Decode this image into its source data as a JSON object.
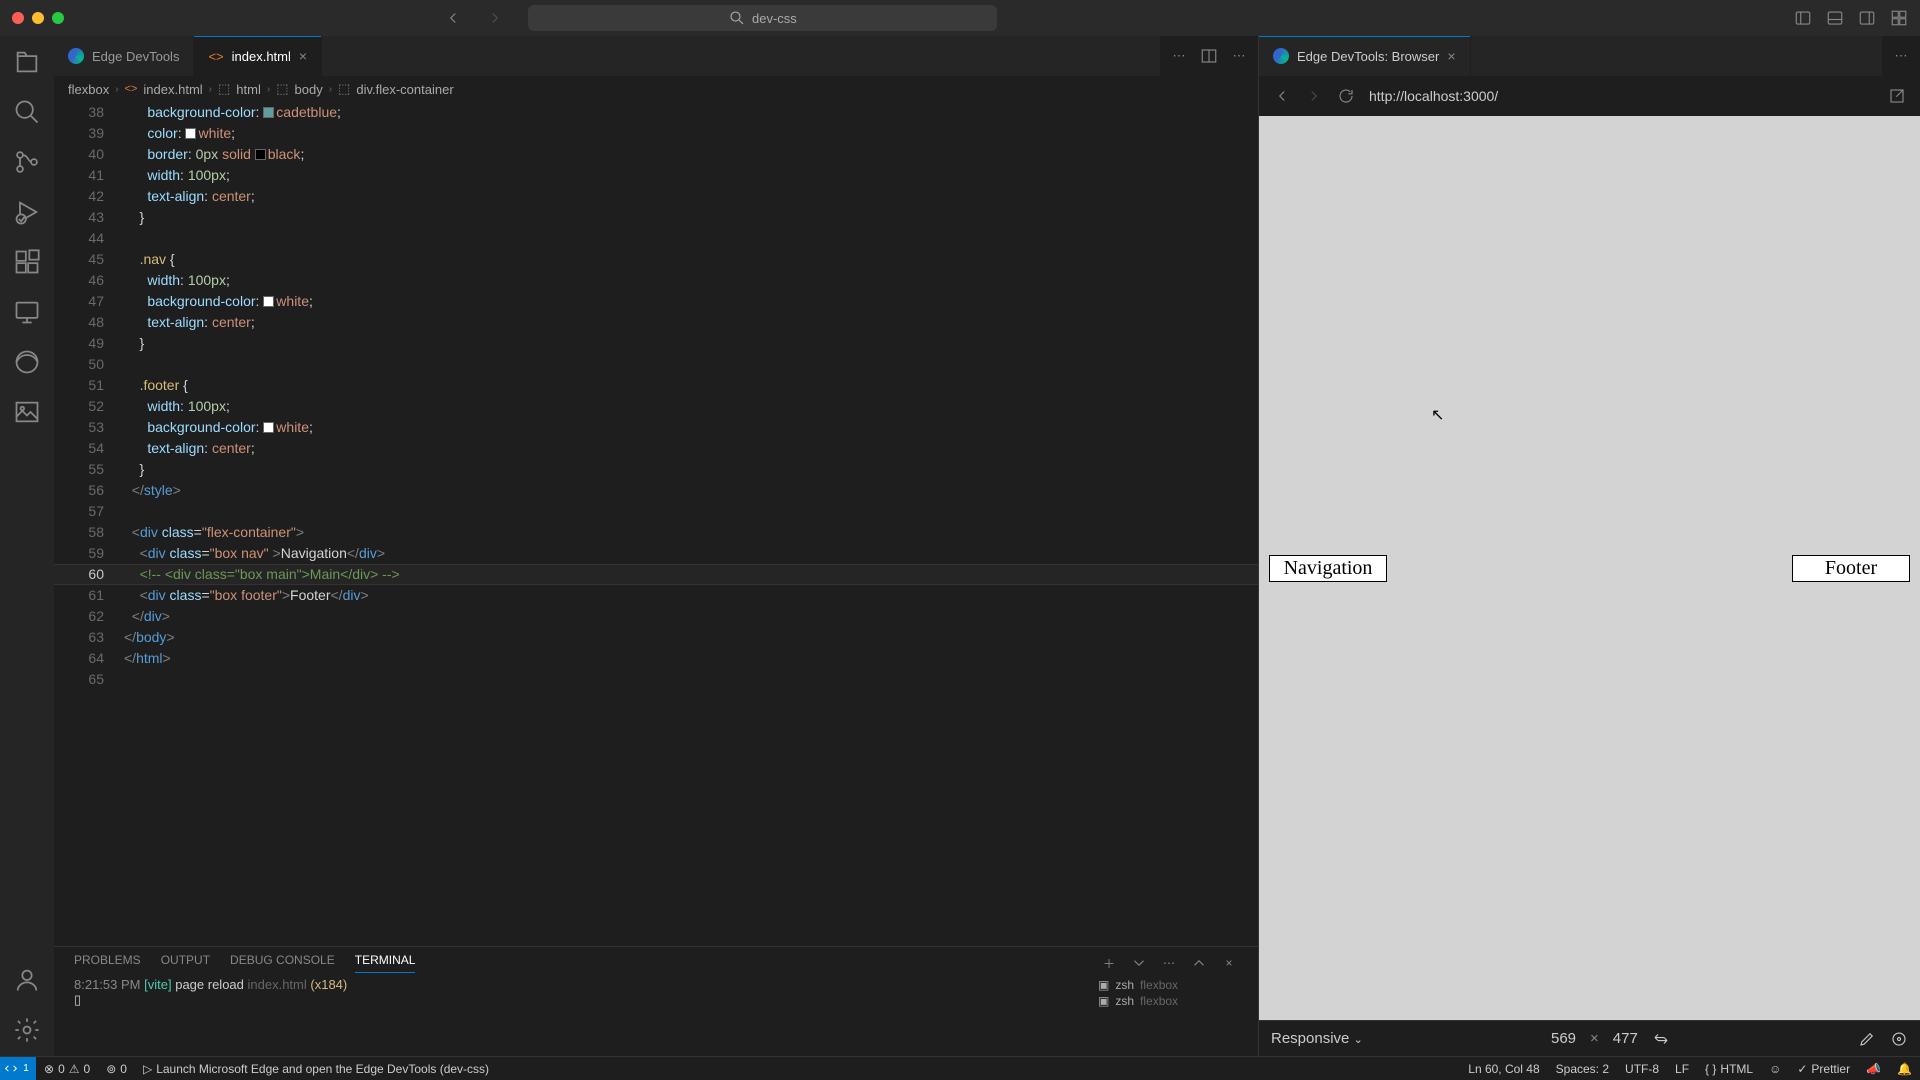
{
  "titlebar": {
    "search": "dev-css"
  },
  "tabs": {
    "left": [
      {
        "label": "Edge DevTools",
        "type": "edge"
      },
      {
        "label": "index.html",
        "type": "html",
        "active": true
      }
    ],
    "right": [
      {
        "label": "Edge DevTools: Browser",
        "type": "edge"
      }
    ]
  },
  "breadcrumb": [
    "flexbox",
    "index.html",
    "html",
    "body",
    "div.flex-container"
  ],
  "editor": {
    "first_line": 38,
    "current_line": 60,
    "lines": [
      {
        "html": "      <span class='t-prop'>background-color</span>: <span class='swatch' style='background:#5f9ea0'></span><span class='t-val'>cadetblue</span>;"
      },
      {
        "html": "      <span class='t-prop'>color</span>: <span class='swatch' style='background:#fff'></span><span class='t-val'>white</span>;"
      },
      {
        "html": "      <span class='t-prop'>border</span>: <span class='t-num'>0px</span> <span class='t-val'>solid</span> <span class='swatch' style='background:#000'></span><span class='t-val'>black</span>;"
      },
      {
        "html": "      <span class='t-prop'>width</span>: <span class='t-num'>100px</span>;"
      },
      {
        "html": "      <span class='t-prop'>text-align</span>: <span class='t-val'>center</span>;"
      },
      {
        "html": "    }"
      },
      {
        "html": ""
      },
      {
        "html": "    <span class='t-sel'>.nav</span> {"
      },
      {
        "html": "      <span class='t-prop'>width</span>: <span class='t-num'>100px</span>;"
      },
      {
        "html": "      <span class='t-prop'>background-color</span>: <span class='swatch' style='background:#fff'></span><span class='t-val'>white</span>;"
      },
      {
        "html": "      <span class='t-prop'>text-align</span>: <span class='t-val'>center</span>;"
      },
      {
        "html": "    }"
      },
      {
        "html": ""
      },
      {
        "html": "    <span class='t-sel'>.footer</span> {"
      },
      {
        "html": "      <span class='t-prop'>width</span>: <span class='t-num'>100px</span>;"
      },
      {
        "html": "      <span class='t-prop'>background-color</span>: <span class='swatch' style='background:#fff'></span><span class='t-val'>white</span>;"
      },
      {
        "html": "      <span class='t-prop'>text-align</span>: <span class='t-val'>center</span>;"
      },
      {
        "html": "    }"
      },
      {
        "html": "  <span class='t-punc'>&lt;/</span><span class='t-tag'>style</span><span class='t-punc'>&gt;</span>"
      },
      {
        "html": ""
      },
      {
        "html": "  <span class='t-punc'>&lt;</span><span class='t-tag'>div</span> <span class='t-attr'>class</span>=<span class='t-str'>\"flex-container\"</span><span class='t-punc'>&gt;</span>"
      },
      {
        "html": "    <span class='t-punc'>&lt;</span><span class='t-tag'>div</span> <span class='t-attr'>class</span>=<span class='t-str'>\"box nav\"</span> <span class='t-punc'>&gt;</span><span class='t-txt'>Navigation</span><span class='t-punc'>&lt;/</span><span class='t-tag'>div</span><span class='t-punc'>&gt;</span>"
      },
      {
        "html": "    <span class='t-cmt'>&lt;!-- &lt;div class=\"box main\"&gt;Main&lt;/div&gt; --&gt;</span>"
      },
      {
        "html": "    <span class='t-punc'>&lt;</span><span class='t-tag'>div</span> <span class='t-attr'>class</span>=<span class='t-str'>\"box footer\"</span><span class='t-punc'>&gt;</span><span class='t-txt'>Footer</span><span class='t-punc'>&lt;/</span><span class='t-tag'>div</span><span class='t-punc'>&gt;</span>"
      },
      {
        "html": "  <span class='t-punc'>&lt;/</span><span class='t-tag'>div</span><span class='t-punc'>&gt;</span>"
      },
      {
        "html": "<span class='t-punc'>&lt;/</span><span class='t-tag'>body</span><span class='t-punc'>&gt;</span>"
      },
      {
        "html": "<span class='t-punc'>&lt;/</span><span class='t-tag'>html</span><span class='t-punc'>&gt;</span>"
      },
      {
        "html": ""
      }
    ]
  },
  "browser": {
    "url": "http://localhost:3000/",
    "nav_box": "Navigation",
    "footer_box": "Footer",
    "device": "Responsive",
    "width": "569",
    "height": "477"
  },
  "panel": {
    "tabs": [
      "PROBLEMS",
      "OUTPUT",
      "DEBUG CONSOLE",
      "TERMINAL"
    ],
    "active_tab": "TERMINAL",
    "line_time": "8:21:53 PM",
    "line_vite": "[vite]",
    "line_msg": "page reload",
    "line_path": "index.html",
    "line_count": "(x184)",
    "prompt": "▯",
    "sessions": [
      {
        "shell": "zsh",
        "cwd": "flexbox"
      },
      {
        "shell": "zsh",
        "cwd": "flexbox"
      }
    ]
  },
  "status": {
    "badge": "1",
    "errors": "0",
    "warnings": "0",
    "ports": "0",
    "launch": "Launch Microsoft Edge and open the Edge DevTools (dev-css)",
    "lncol": "Ln 60, Col 48",
    "spaces": "Spaces: 2",
    "encoding": "UTF-8",
    "eol": "LF",
    "lang": "HTML",
    "prettier": "Prettier"
  }
}
